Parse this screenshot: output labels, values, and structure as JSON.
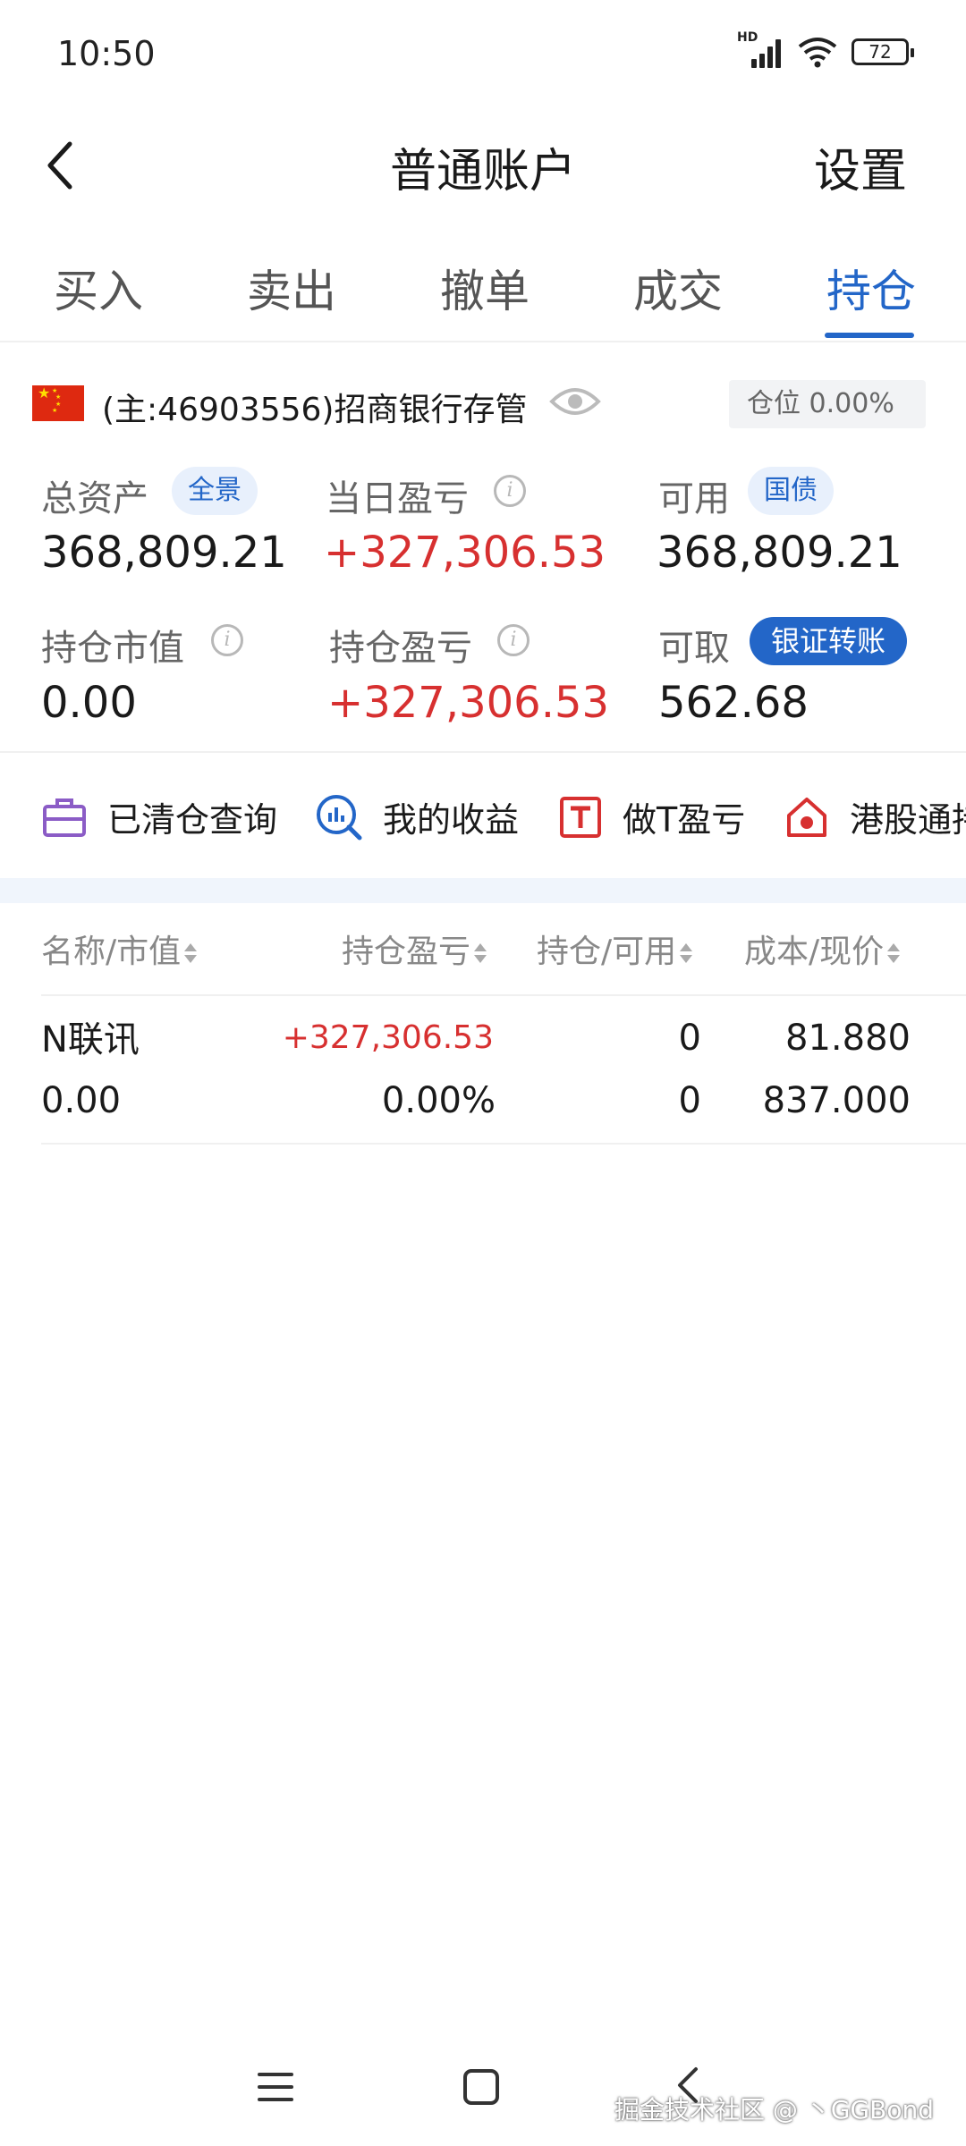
{
  "status_bar": {
    "time": "10:50",
    "network": "HD",
    "battery": "72"
  },
  "header": {
    "title": "普通账户",
    "settings": "设置"
  },
  "tabs": [
    {
      "label": "买入",
      "active": false
    },
    {
      "label": "卖出",
      "active": false
    },
    {
      "label": "撤单",
      "active": false
    },
    {
      "label": "成交",
      "active": false
    },
    {
      "label": "持仓",
      "active": true
    }
  ],
  "account": {
    "label": "(主:46903556)招商银行存管",
    "position_ratio": "仓位 0.00%"
  },
  "metrics": {
    "total_assets": {
      "label": "总资产",
      "badge": "全景",
      "value": "368,809.21"
    },
    "daily_pl": {
      "label": "当日盈亏",
      "value": "+327,306.53"
    },
    "available": {
      "label": "可用",
      "badge": "国债",
      "value": "368,809.21"
    },
    "market_value": {
      "label": "持仓市值",
      "value": "0.00"
    },
    "position_pl": {
      "label": "持仓盈亏",
      "value": "+327,306.53"
    },
    "withdrawable": {
      "label": "可取",
      "button": "银证转账",
      "value": "562.68"
    }
  },
  "quick_actions": [
    {
      "label": "已清仓查询",
      "icon": "briefcase-icon"
    },
    {
      "label": "我的收益",
      "icon": "chart-search-icon"
    },
    {
      "label": "做T盈亏",
      "icon": "t-box-icon"
    },
    {
      "label": "港股通持",
      "icon": "hk-house-icon"
    }
  ],
  "table": {
    "headers": [
      "名称/市值",
      "持仓盈亏",
      "持仓/可用",
      "成本/现价"
    ],
    "rows": [
      {
        "name": "N联讯",
        "market_value": "0.00",
        "pl": "+327,306.53",
        "pl_pct": "0.00%",
        "position": "0",
        "available": "0",
        "cost": "81.880",
        "price": "837.000"
      }
    ]
  },
  "watermark": "掘金技术社区 @ 丶GGBond",
  "colors": {
    "accent": "#2366c8",
    "profit": "#d73030",
    "muted": "#888888"
  }
}
